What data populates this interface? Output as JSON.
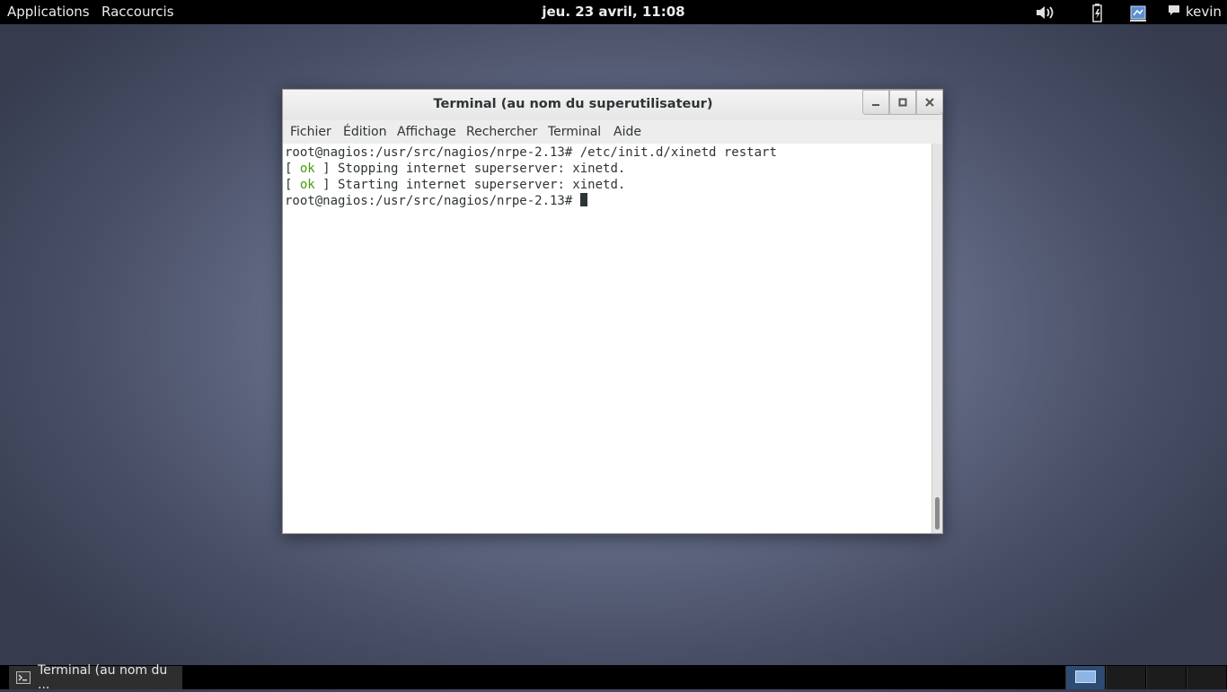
{
  "top_panel": {
    "applications": "Applications",
    "shortcuts": "Raccourcis",
    "clock": "jeu. 23 avril, 11:08",
    "user": "kevin",
    "icons": [
      "volume-icon",
      "power-icon",
      "network-icon",
      "chat-icon"
    ]
  },
  "window": {
    "title": "Terminal (au nom du superutilisateur)",
    "menu": {
      "fichier": "Fichier",
      "edition": "Édition",
      "affichage": "Affichage",
      "rechercher": "Rechercher",
      "terminal": "Terminal",
      "aide": "Aide"
    },
    "lines": {
      "l1": "root@nagios:/usr/src/nagios/nrpe-2.13# /etc/init.d/xinetd restart",
      "l2_pre": "[ ",
      "l2_ok": "ok",
      "l2_post": " ] Stopping internet superserver: xinetd.",
      "l3_pre": "[ ",
      "l3_ok": "ok",
      "l3_post": " ] Starting internet superserver: xinetd.",
      "l4": "root@nagios:/usr/src/nagios/nrpe-2.13# "
    }
  },
  "taskbar": {
    "task_label": "Terminal (au nom du ..."
  },
  "colors": {
    "ok_green": "#4e9a06",
    "panel_bg": "#000000",
    "active_workspace": "#2d4b73"
  }
}
